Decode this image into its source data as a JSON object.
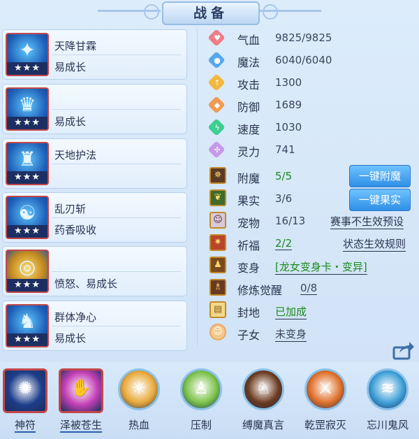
{
  "title": "战备",
  "equipment": [
    {
      "line1": "天降甘霖",
      "line2": "易成长",
      "stars": "★★★",
      "icon": "blue-spear-icon",
      "glyph": "✦"
    },
    {
      "line1": "",
      "line2": "易成长",
      "stars": "★★★",
      "icon": "blue-helmet-icon",
      "glyph": "♛"
    },
    {
      "line1": "天地护法",
      "line2": "",
      "stars": "★★★",
      "icon": "blue-armor-icon",
      "glyph": "♜"
    },
    {
      "line1": "乱刃斩",
      "line2": "药香吸收",
      "stars": "★★★",
      "icon": "blue-necklace-icon",
      "glyph": "☯"
    },
    {
      "line1": "",
      "line2": "愤怒、易成长",
      "stars": "★★★",
      "icon": "gold-belt-icon",
      "glyph": "◎"
    },
    {
      "line1": "群体净心",
      "line2": "易成长",
      "stars": "★★★",
      "icon": "blue-boots-icon",
      "glyph": "♞"
    }
  ],
  "stats": [
    {
      "name": "气血",
      "value": "9825/9825",
      "icon": "heart-icon",
      "color": "#ef7d85",
      "glyph": "♥"
    },
    {
      "name": "魔法",
      "value": "6040/6040",
      "icon": "mana-icon",
      "color": "#55a7ef",
      "glyph": "●"
    },
    {
      "name": "攻击",
      "value": "1300",
      "icon": "sword-icon",
      "color": "#f2b83c",
      "glyph": "↑"
    },
    {
      "name": "防御",
      "value": "1689",
      "icon": "shield-icon",
      "color": "#f09a52",
      "glyph": "◆"
    },
    {
      "name": "速度",
      "value": "1030",
      "icon": "speed-icon",
      "color": "#3ccf8f",
      "glyph": "ϟ"
    },
    {
      "name": "灵力",
      "value": "741",
      "icon": "spirit-icon",
      "color": "#c59be9",
      "glyph": "✢"
    }
  ],
  "extras": {
    "enchant": {
      "name": "附魔",
      "value": "5/5"
    },
    "fruit": {
      "name": "果实",
      "value": "3/6"
    },
    "pet": {
      "name": "宠物",
      "value": "16/13"
    },
    "blessing": {
      "name": "祈福",
      "value": "2/2"
    },
    "transform": {
      "name": "变身",
      "value": "[龙女变身卡・变异]"
    },
    "cultivation": {
      "name": "修炼觉醒",
      "value": "0/8"
    },
    "fief": {
      "name": "封地",
      "value": "已加成"
    },
    "child": {
      "name": "子女",
      "value": "未变身"
    }
  },
  "buttons": {
    "enchant": "一键附魔",
    "fruit": "一键果实"
  },
  "links": {
    "event_preset": "赛事不生效预设",
    "status_rules": "状态生效规则"
  },
  "skills": [
    {
      "label": "神符",
      "icon": "blue-rune-icon",
      "glyph": "✺",
      "bg": "#1d3d8a"
    },
    {
      "label": "泽被苍生",
      "icon": "pink-hand-icon",
      "glyph": "✋",
      "bg": "#c23fb5"
    },
    {
      "label": "热血",
      "icon": "fire-dancer-icon",
      "glyph": "☼",
      "bg": "#e8a93a"
    },
    {
      "label": "压制",
      "icon": "green-figure-icon",
      "glyph": "♙",
      "bg": "#7cc24a"
    },
    {
      "label": "缚魔真言",
      "icon": "beast-icon",
      "glyph": "♘",
      "bg": "#6b3a1e"
    },
    {
      "label": "乾罡寂灭",
      "icon": "orange-blade-icon",
      "glyph": "⚔",
      "bg": "#e0702a"
    },
    {
      "label": "忘川鬼风",
      "icon": "blue-wind-icon",
      "glyph": "≋",
      "bg": "#3fa0d8"
    }
  ]
}
